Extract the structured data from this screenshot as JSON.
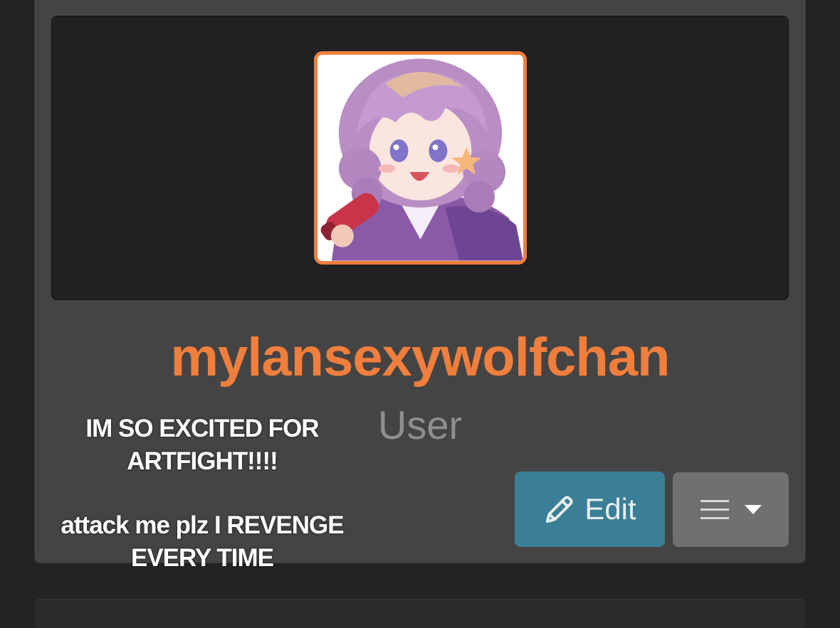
{
  "profile": {
    "username": "mylansexywolfchan",
    "role": "User"
  },
  "actions": {
    "edit_label": "Edit"
  },
  "overlay_caption": {
    "line1": "IM SO EXCITED FOR ARTFIGHT!!!!",
    "line2": "attack me plz I REVENGE EVERY TIME"
  },
  "icons": {
    "avatar": "avatar-illustration",
    "edit": "pencil-icon",
    "menu": "hamburger-menu-icon",
    "dropdown": "caret-down-icon"
  },
  "colors": {
    "background": "#232323",
    "card": "#444444",
    "banner": "#212121",
    "accent": "#f07e3c",
    "edit_button": "#3a7f95",
    "menu_button": "#707070",
    "role_text": "#8f8f8f"
  }
}
